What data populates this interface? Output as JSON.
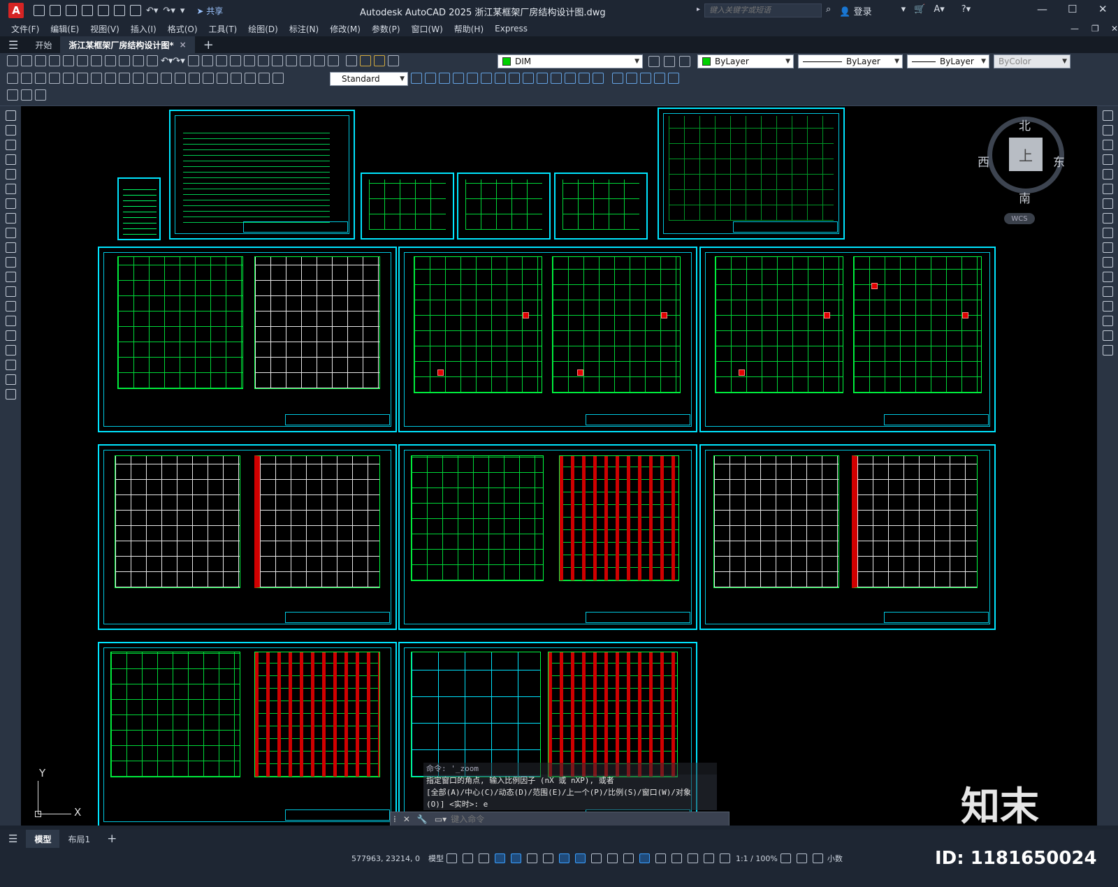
{
  "app": {
    "logo": "A",
    "share": "共享",
    "title": "Autodesk AutoCAD 2025    浙江某框架厂房结构设计图.dwg",
    "search_placeholder": "键入关键字或短语",
    "login": "登录"
  },
  "menu": [
    "文件(F)",
    "编辑(E)",
    "视图(V)",
    "插入(I)",
    "格式(O)",
    "工具(T)",
    "绘图(D)",
    "标注(N)",
    "修改(M)",
    "参数(P)",
    "窗口(W)",
    "帮助(H)",
    "Express"
  ],
  "tabs": {
    "start": "开始",
    "doc": "浙江某框架厂房结构设计图*",
    "close": "×",
    "add": "+"
  },
  "toolbar": {
    "layer": "DIM",
    "color": "ByLayer",
    "linetype": "ByLayer",
    "lineweight": "ByLayer",
    "plotstyle": "ByColor",
    "dimstyle": "Standard",
    "accent": "#00e5ff"
  },
  "viewcube": {
    "north": "北",
    "south": "南",
    "east": "东",
    "west": "西",
    "face": "上",
    "wcs": "WCS"
  },
  "ucs": {
    "x": "X",
    "y": "Y"
  },
  "command": {
    "lines": [
      "命令: '_zoom",
      "指定窗口的角点, 输入比例因子 (nX 或 nXP), 或者",
      "[全部(A)/中心(C)/动态(D)/范围(E)/上一个(P)/比例(S)/窗口(W)/对象",
      "(O)] <实时>: e"
    ],
    "placeholder": "键入命令"
  },
  "watermark": {
    "brand": "知末",
    "id": "ID: 1181650024"
  },
  "bottom_tabs": {
    "model": "模型",
    "layout": "布局1",
    "add": "+"
  },
  "status": {
    "coords": "577963, 23214, 0",
    "model": "模型",
    "scale": "1:1 / 100%",
    "units": "小数"
  }
}
